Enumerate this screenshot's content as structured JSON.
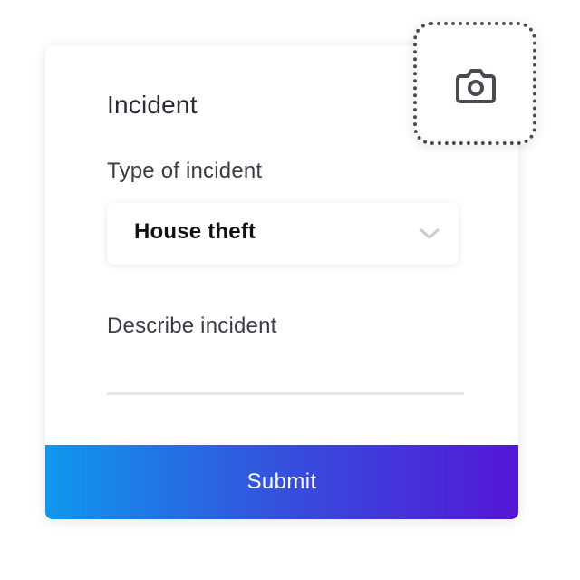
{
  "form": {
    "title": "Incident",
    "type_label": "Type of incident",
    "type_value": "House theft",
    "describe_label": "Describe incident",
    "describe_value": "",
    "submit_label": "Submit"
  },
  "icons": {
    "select_chevron": "chevron-down-icon",
    "photo_upload": "camera-icon"
  },
  "colors": {
    "gradient_start": "#0f98ee",
    "gradient_end": "#5417d6",
    "text": "#2b2b33",
    "divider": "#e4e7ea"
  }
}
